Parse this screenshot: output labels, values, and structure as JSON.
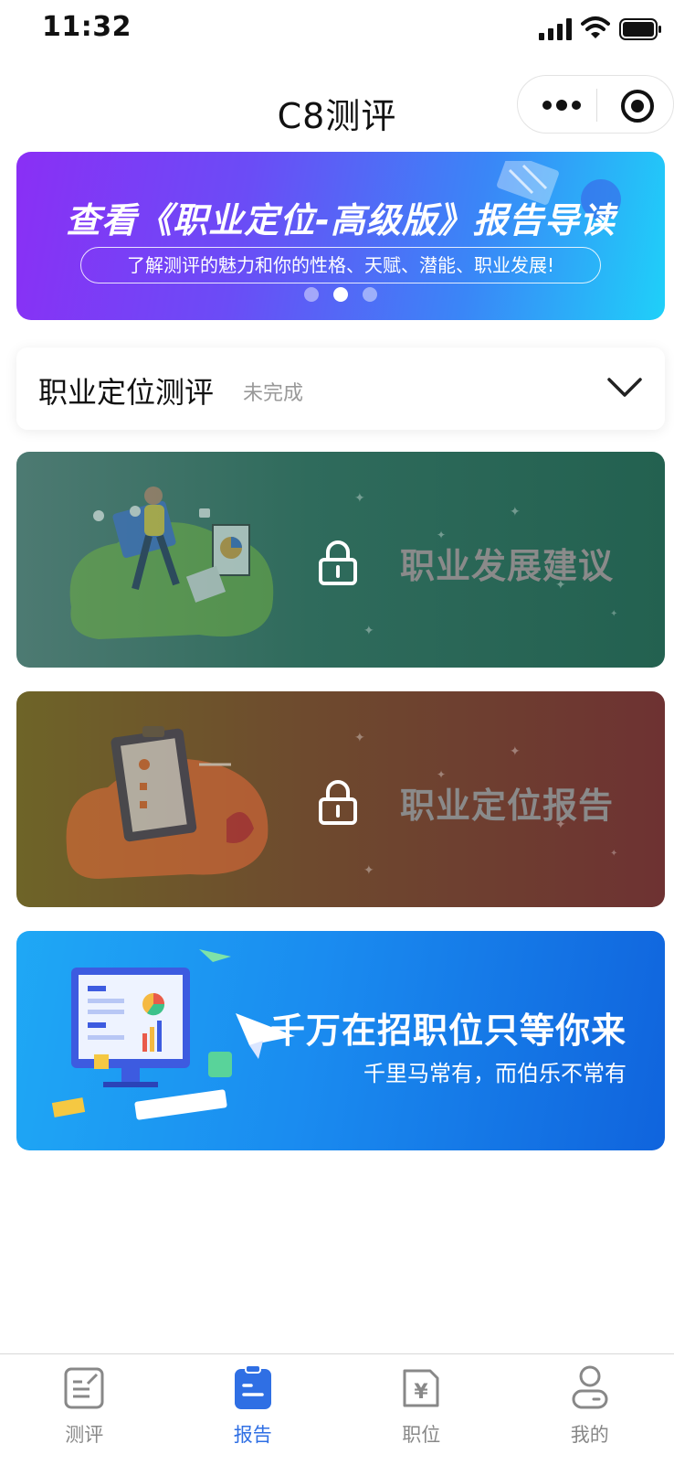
{
  "status_bar": {
    "time": "11:32"
  },
  "nav": {
    "title": "C8测评"
  },
  "banner": {
    "title": "查看《职业定位-高级版》报告导读",
    "subtitle": "了解测评的魅力和你的性格、天赋、潜能、职业发展!",
    "carousel_active_index": 1,
    "carousel_count": 3
  },
  "assessment": {
    "title": "职业定位测评",
    "status": "未完成"
  },
  "locked_cards": [
    {
      "label": "职业发展建议",
      "color": "#2f6b5c"
    },
    {
      "label": "职业定位报告",
      "color": "#6e4a2e"
    }
  ],
  "recruit": {
    "title": "千万在招职位只等你来",
    "subtitle": "千里马常有，而伯乐不常有"
  },
  "tabs": [
    {
      "label": "测评",
      "icon": "assessment-icon"
    },
    {
      "label": "报告",
      "icon": "report-icon"
    },
    {
      "label": "职位",
      "icon": "job-icon"
    },
    {
      "label": "我的",
      "icon": "profile-icon"
    }
  ],
  "active_tab_index": 1,
  "colors": {
    "accent": "#2f6fe4"
  }
}
